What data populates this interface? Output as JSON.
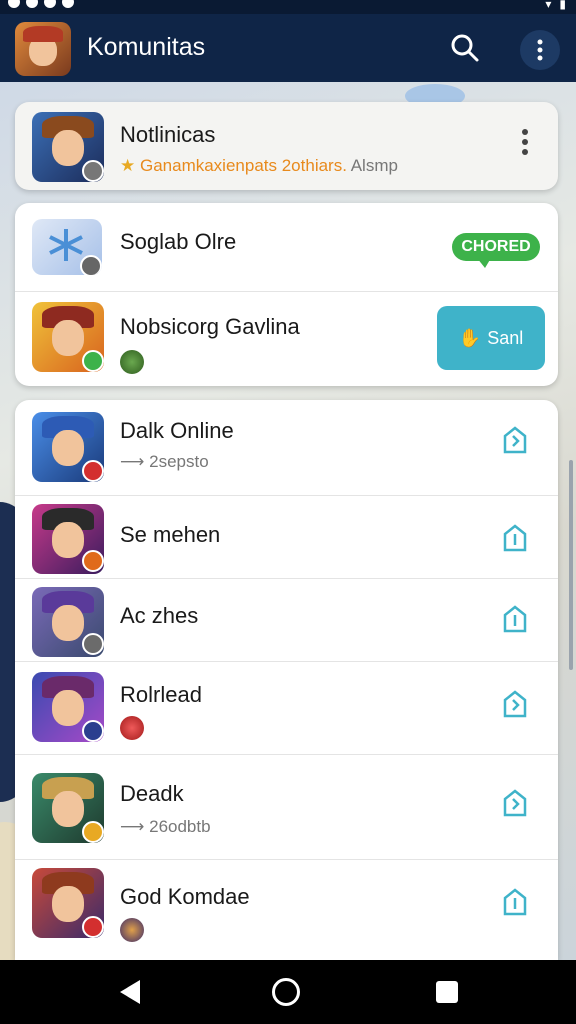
{
  "app": {
    "title": "Komunitas",
    "icons": {
      "search": "search-icon",
      "more": "more-vertical-icon"
    }
  },
  "notification": {
    "title": "Notlinicas",
    "subtitle_highlight": "Ganamkaxienpats 2othiars.",
    "subtitle_rest": " Alsmp",
    "icon": "star-icon"
  },
  "groups": [
    {
      "title": "Soglab Olre",
      "chip": "CHORED"
    },
    {
      "title": "Nobsicorg Gavlina",
      "button": "Sanl"
    }
  ],
  "games": [
    {
      "title": "Dalk Online",
      "sub": "2sepsto"
    },
    {
      "title": "Se mehen",
      "sub": ""
    },
    {
      "title": "Ac zhes",
      "sub": ""
    },
    {
      "title": "Rolrlead",
      "sub": ""
    },
    {
      "title": "Deadk",
      "sub": "26odbtb"
    },
    {
      "title": "God Komdae",
      "sub": ""
    }
  ],
  "colors": {
    "appbar": "#0f2547",
    "accent_teal": "#3fb3c9",
    "chip_green": "#3db24a"
  }
}
